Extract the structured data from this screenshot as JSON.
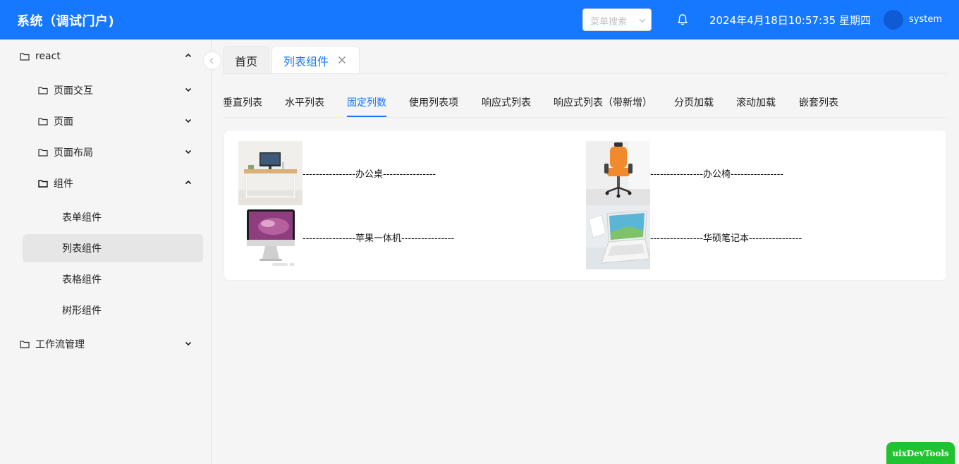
{
  "header": {
    "title": "系统（调试门户)",
    "menu_search_placeholder": "菜单搜索",
    "datetime": "2024年4月18日10:57:35 星期四",
    "username": "system",
    "colors": {
      "primary": "#1677ff",
      "avatar": "#0f5bd4"
    }
  },
  "sidebar": {
    "items": [
      {
        "label": "react",
        "icon": "folder-icon",
        "caret": "chevron-up-icon"
      },
      {
        "label": "页面交互",
        "icon": "folder-icon",
        "caret": "chevron-down-icon"
      },
      {
        "label": "页面",
        "icon": "folder-icon",
        "caret": "chevron-down-icon"
      },
      {
        "label": "页面布局",
        "icon": "folder-icon",
        "caret": "chevron-down-icon"
      },
      {
        "label": "组件",
        "icon": "folder-icon",
        "caret": "chevron-up-icon"
      },
      {
        "label": "表单组件"
      },
      {
        "label": "列表组件",
        "selected": true
      },
      {
        "label": "表格组件"
      },
      {
        "label": "树形组件"
      },
      {
        "label": "工作流管理",
        "icon": "folder-icon",
        "caret": "chevron-down-icon"
      }
    ]
  },
  "tabs": [
    {
      "label": "首页"
    },
    {
      "label": "列表组件",
      "active": true,
      "closable": true
    }
  ],
  "subtabs": [
    {
      "label": "垂直列表"
    },
    {
      "label": "水平列表"
    },
    {
      "label": "固定列数",
      "active": true
    },
    {
      "label": "使用列表项"
    },
    {
      "label": "响应式列表"
    },
    {
      "label": "响应式列表（带新增）"
    },
    {
      "label": "分页加载"
    },
    {
      "label": "滚动加载"
    },
    {
      "label": "嵌套列表"
    }
  ],
  "list": {
    "items": [
      {
        "label": "----------------办公桌----------------",
        "image": "office-desk-image"
      },
      {
        "label": "----------------办公椅----------------",
        "image": "office-chair-image"
      },
      {
        "label": "----------------苹果一体机----------------",
        "image": "imac-image"
      },
      {
        "label": "----------------华硕笔记本----------------",
        "image": "laptop-image"
      }
    ]
  },
  "devtools": {
    "label": "uixDevTools",
    "color": "#1fc22f"
  }
}
